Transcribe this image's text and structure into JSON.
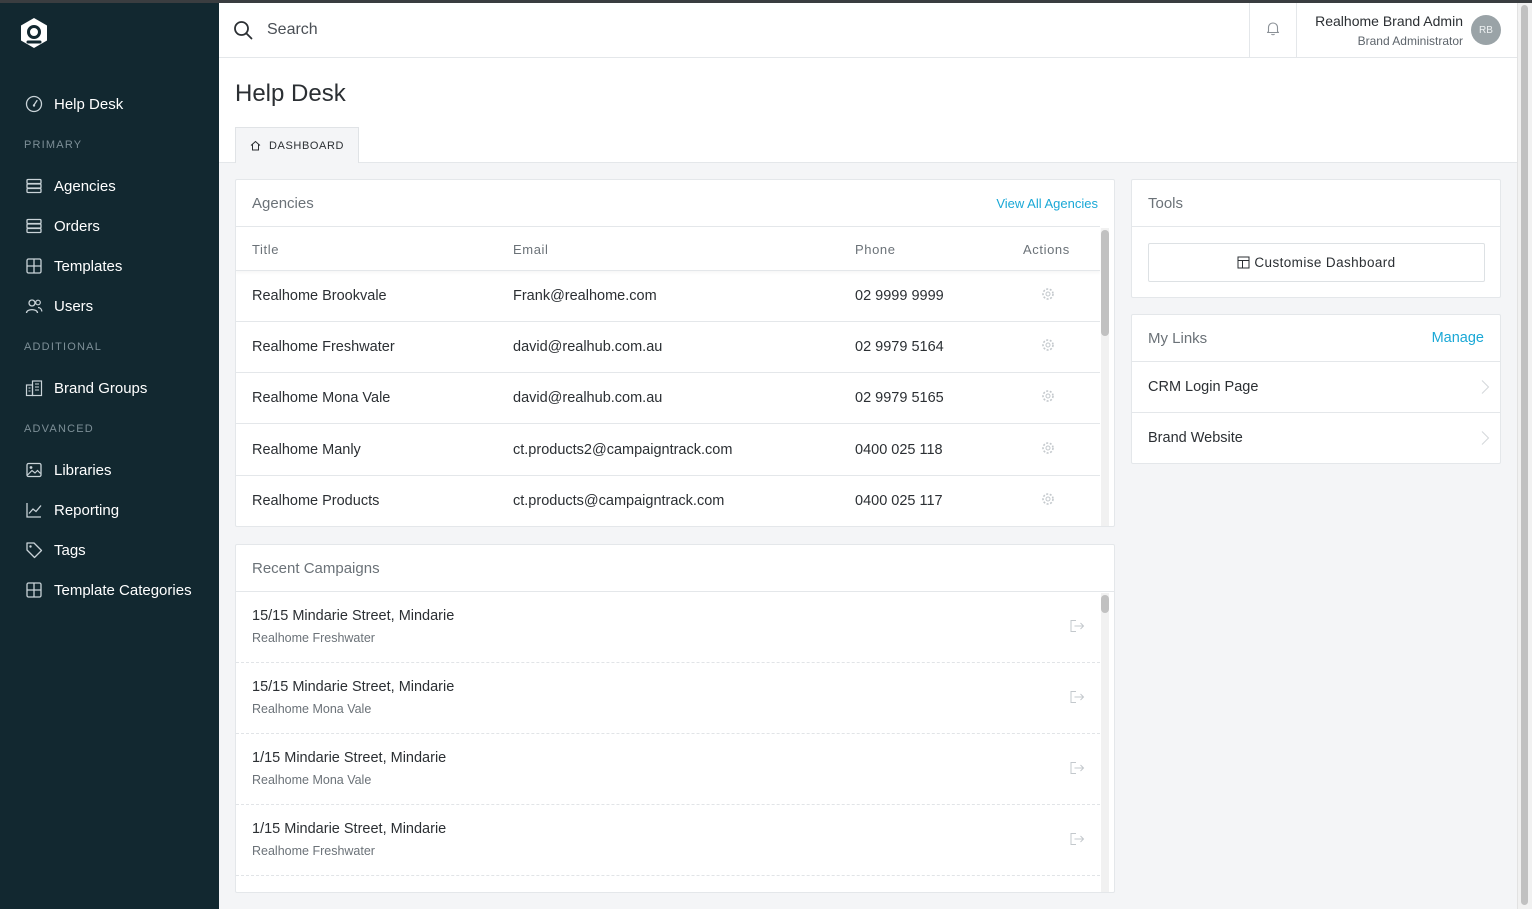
{
  "sidebar": {
    "items": [
      {
        "label": "Help Desk",
        "icon": "dashboard-gauge-icon"
      },
      {
        "label": "Agencies",
        "icon": "stack-icon"
      },
      {
        "label": "Orders",
        "icon": "stack-icon"
      },
      {
        "label": "Templates",
        "icon": "grid-icon"
      },
      {
        "label": "Users",
        "icon": "users-icon"
      },
      {
        "label": "Brand Groups",
        "icon": "buildings-icon"
      },
      {
        "label": "Libraries",
        "icon": "image-icon"
      },
      {
        "label": "Reporting",
        "icon": "chart-line-icon"
      },
      {
        "label": "Tags",
        "icon": "tag-icon"
      },
      {
        "label": "Template Categories",
        "icon": "grid-icon"
      }
    ],
    "sections": {
      "primary": "PRIMARY",
      "additional": "ADDITIONAL",
      "advanced": "ADVANCED"
    }
  },
  "header": {
    "search_placeholder": "Search",
    "user_name": "Realhome Brand Admin",
    "user_role": "Brand Administrator",
    "avatar_initials": "RB"
  },
  "page": {
    "title": "Help Desk",
    "tab_label": "DASHBOARD"
  },
  "agencies": {
    "title": "Agencies",
    "view_all": "View All Agencies",
    "columns": [
      "Title",
      "Email",
      "Phone",
      "Actions"
    ],
    "rows": [
      {
        "title": "Realhome Brookvale",
        "email": "Frank@realhome.com",
        "phone": "02 9999 9999"
      },
      {
        "title": "Realhome Freshwater",
        "email": "david@realhub.com.au",
        "phone": "02 9979 5164"
      },
      {
        "title": "Realhome Mona Vale",
        "email": "david@realhub.com.au",
        "phone": "02 9979 5165"
      },
      {
        "title": "Realhome Manly",
        "email": "ct.products2@campaigntrack.com",
        "phone": "0400 025 118"
      },
      {
        "title": "Realhome Products",
        "email": "ct.products@campaigntrack.com",
        "phone": "0400 025 117"
      }
    ]
  },
  "campaigns": {
    "title": "Recent Campaigns",
    "items": [
      {
        "address": "15/15 Mindarie Street, Mindarie",
        "agency": "Realhome Freshwater"
      },
      {
        "address": "15/15 Mindarie Street, Mindarie",
        "agency": "Realhome Mona Vale"
      },
      {
        "address": "1/15 Mindarie Street, Mindarie",
        "agency": "Realhome Mona Vale"
      },
      {
        "address": "1/15 Mindarie Street, Mindarie",
        "agency": "Realhome Freshwater"
      }
    ]
  },
  "tools": {
    "title": "Tools",
    "customise_label": "Customise Dashboard"
  },
  "links": {
    "title": "My Links",
    "manage": "Manage",
    "items": [
      "CRM Login Page",
      "Brand Website"
    ]
  },
  "colors": {
    "sidebar_bg": "#122830",
    "accent": "#1aa8d6",
    "page_bg": "#f4f5f7"
  }
}
